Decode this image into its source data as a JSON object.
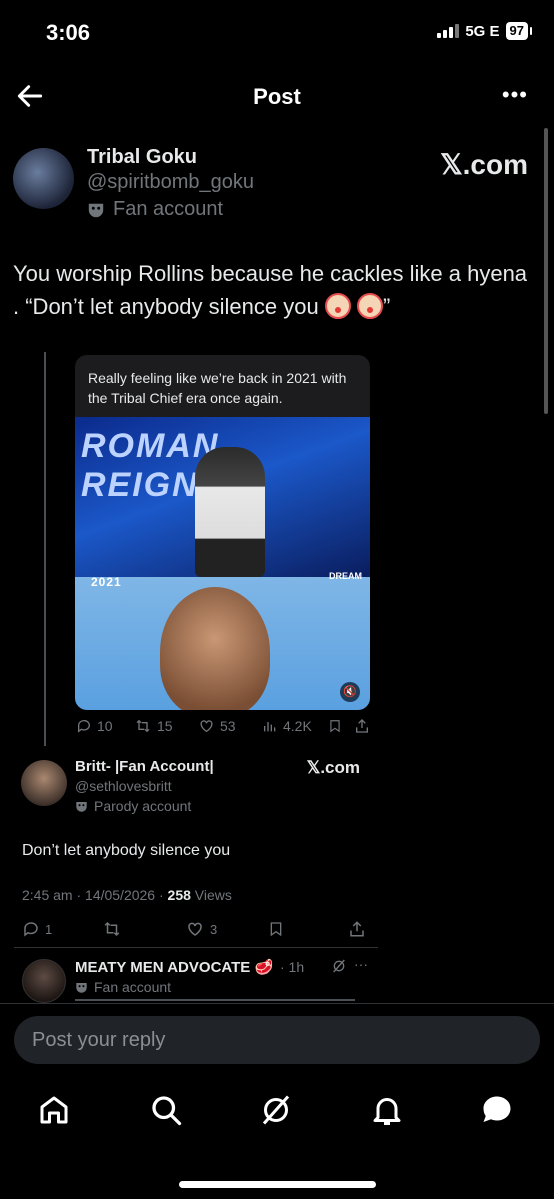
{
  "status_bar": {
    "time": "3:06",
    "network": "5G E",
    "battery": "97"
  },
  "header": {
    "title": "Post"
  },
  "post": {
    "author_name": "Tribal Goku",
    "author_handle": "@spiritbomb_goku",
    "badge": "Fan account",
    "watermark": "𝕏.com",
    "text": "You worship Rollins because he cackles like a hyena . “Don’t let anybody silence you",
    "text_end": "”"
  },
  "quoted": {
    "caption": "Really feeling like we’re back in 2021 with the Tribal Chief era once again.",
    "banner": "ROMAN REIGNS",
    "year_label": "2021",
    "dream_label": "DREAM",
    "replies": "10",
    "reposts": "15",
    "likes": "53",
    "views": "4.2K"
  },
  "reply": {
    "author_name": "Britt- |Fan Account|",
    "author_handle": "@sethlovesbritt",
    "badge": "Parody account",
    "watermark": "𝕏.com",
    "text": "Don’t let anybody silence you",
    "time": "2:45 am · 14/05/2026 · ",
    "views_count": "258",
    "views_label": " Views",
    "replies": "1",
    "likes": "3"
  },
  "third_reply": {
    "author_name": "MEATY MEN ADVOCATE 🥩",
    "time": "· 1h",
    "badge": "Fan account"
  },
  "compose": {
    "placeholder": "Post your reply"
  },
  "icons": [
    "back-arrow-icon",
    "more-icon",
    "mask-icon",
    "reply-icon",
    "repost-icon",
    "like-icon",
    "views-icon",
    "bookmark-icon",
    "share-icon",
    "mute-icon",
    "grok-icon",
    "home-icon",
    "search-icon",
    "notifications-icon",
    "messages-icon"
  ],
  "colors": {
    "background": "#000000",
    "text": "#e7e9ea",
    "muted": "#71767b",
    "input": "#202327"
  }
}
